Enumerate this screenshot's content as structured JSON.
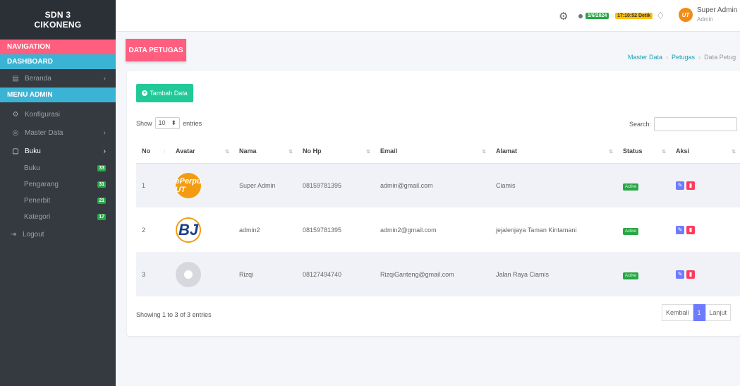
{
  "sidebar": {
    "brand_line1": "SDN 3",
    "brand_line2": "CIKONENG",
    "navigation": "NAVIGATION",
    "dashboard": "DASHBOARD",
    "beranda": "Beranda",
    "menu_admin": "MENU ADMIN",
    "konfigurasi": "Konfigurasi",
    "master_data": "Master Data",
    "buku_group": "Buku",
    "sub": [
      {
        "label": "Buku",
        "count": "33"
      },
      {
        "label": "Pengarang",
        "count": "31"
      },
      {
        "label": "Penerbit",
        "count": "21"
      },
      {
        "label": "Kategori",
        "count": "17"
      }
    ],
    "logout": "Logout"
  },
  "topbar": {
    "date": "1/6/2024",
    "time": "17:10:52 Detik",
    "user_name": "Super Admin",
    "user_role": "Admin"
  },
  "page": {
    "title": "DATA PETUGAS",
    "breadcrumb": [
      "Master Data",
      "Petugas",
      "Data Petug"
    ]
  },
  "card": {
    "add_label": "Tambah Data",
    "show_label": "Show",
    "show_value": "10",
    "entries_label": "entries",
    "search_label": "Search:",
    "columns": [
      "No",
      "Avatar",
      "Nama",
      "No Hp",
      "Email",
      "Alamat",
      "Status",
      "Aksi"
    ],
    "rows": [
      {
        "no": "1",
        "avatar_text": "ePerpu UT",
        "nama": "Super Admin",
        "hp": "08159781395",
        "email": "admin@gmail.com",
        "alamat": "Ciamis",
        "status": "Active"
      },
      {
        "no": "2",
        "avatar_text": "BJ",
        "nama": "admin2",
        "hp": "08159781395",
        "email": "admin2@gmail.com",
        "alamat": "jejalenjaya Taman Kintamani",
        "status": "Active"
      },
      {
        "no": "3",
        "avatar_text": "",
        "nama": "Rizqi",
        "hp": "08127494740",
        "email": "RizqiGanteng@gmail.com",
        "alamat": "Jalan Raya Ciamis",
        "status": "Active"
      }
    ],
    "info": "Showing 1 to 3 of 3 entries",
    "pager": {
      "prev": "Kembali",
      "page": "1",
      "next": "Lanjut"
    }
  }
}
